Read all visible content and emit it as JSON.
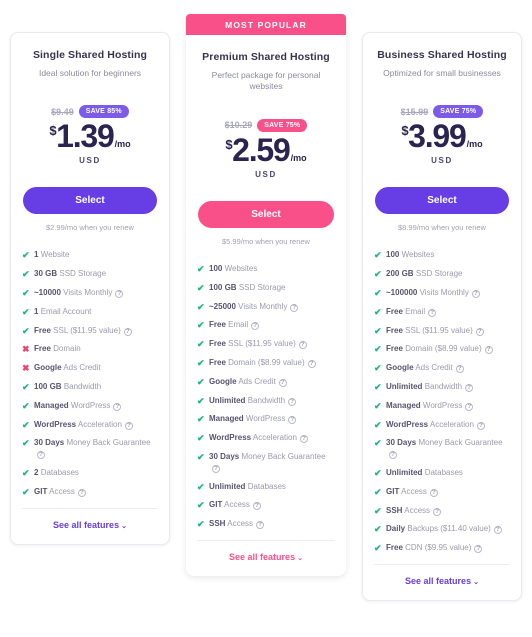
{
  "plans": [
    {
      "ribbon": null,
      "name": "Single Shared Hosting",
      "tagline": "Ideal solution for beginners",
      "old_price": "$9.49",
      "save_badge": "SAVE 85%",
      "currency_symbol": "$",
      "amount": "1.39",
      "per": "/mo",
      "currency_code": "USD",
      "select_label": "Select",
      "renew_note": "$2.99/mo when you renew",
      "see_all_label": "See all features",
      "accent": "#673de6",
      "features": [
        {
          "mark": "check",
          "bold": "1",
          "rest": "Website",
          "info": false
        },
        {
          "mark": "check",
          "bold": "30 GB",
          "rest": "SSD Storage",
          "info": false
        },
        {
          "mark": "check",
          "bold": "~10000",
          "rest": "Visits Monthly",
          "info": true
        },
        {
          "mark": "check",
          "bold": "1",
          "rest": "Email Account",
          "info": false
        },
        {
          "mark": "check",
          "bold": "Free",
          "rest": "SSL ($11.95 value)",
          "info": true
        },
        {
          "mark": "cross",
          "bold": "Free",
          "rest": "Domain",
          "info": false
        },
        {
          "mark": "cross",
          "bold": "Google",
          "rest": "Ads Credit",
          "info": false
        },
        {
          "mark": "check",
          "bold": "100 GB",
          "rest": "Bandwidth",
          "info": false
        },
        {
          "mark": "check",
          "bold": "Managed",
          "rest": "WordPress",
          "info": true
        },
        {
          "mark": "check",
          "bold": "WordPress",
          "rest": "Acceleration",
          "info": true
        },
        {
          "mark": "check",
          "bold": "30 Days",
          "rest": "Money Back Guarantee",
          "info": true
        },
        {
          "mark": "check",
          "bold": "2",
          "rest": "Databases",
          "info": false
        },
        {
          "mark": "check",
          "bold": "GIT",
          "rest": "Access",
          "info": true
        }
      ]
    },
    {
      "ribbon": "MOST POPULAR",
      "name": "Premium Shared Hosting",
      "tagline": "Perfect package for personal websites",
      "old_price": "$10.29",
      "save_badge": "SAVE 75%",
      "currency_symbol": "$",
      "amount": "2.59",
      "per": "/mo",
      "currency_code": "USD",
      "select_label": "Select",
      "renew_note": "$5.99/mo when you renew",
      "see_all_label": "See all features",
      "accent": "#fa5089",
      "features": [
        {
          "mark": "check",
          "bold": "100",
          "rest": "Websites",
          "info": false
        },
        {
          "mark": "check",
          "bold": "100 GB",
          "rest": "SSD Storage",
          "info": false
        },
        {
          "mark": "check",
          "bold": "~25000",
          "rest": "Visits Monthly",
          "info": true
        },
        {
          "mark": "check",
          "bold": "Free",
          "rest": "Email",
          "info": true
        },
        {
          "mark": "check",
          "bold": "Free",
          "rest": "SSL ($11.95 value)",
          "info": true
        },
        {
          "mark": "check",
          "bold": "Free",
          "rest": "Domain ($8.99 value)",
          "info": true
        },
        {
          "mark": "check",
          "bold": "Google",
          "rest": "Ads Credit",
          "info": true
        },
        {
          "mark": "check",
          "bold": "Unlimited",
          "rest": "Bandwidth",
          "info": true
        },
        {
          "mark": "check",
          "bold": "Managed",
          "rest": "WordPress",
          "info": true
        },
        {
          "mark": "check",
          "bold": "WordPress",
          "rest": "Acceleration",
          "info": true
        },
        {
          "mark": "check",
          "bold": "30 Days",
          "rest": "Money Back Guarantee",
          "info": true
        },
        {
          "mark": "check",
          "bold": "Unlimited",
          "rest": "Databases",
          "info": false
        },
        {
          "mark": "check",
          "bold": "GIT",
          "rest": "Access",
          "info": true
        },
        {
          "mark": "check",
          "bold": "SSH",
          "rest": "Access",
          "info": true
        }
      ]
    },
    {
      "ribbon": null,
      "name": "Business Shared Hosting",
      "tagline": "Optimized for small businesses",
      "old_price": "$15.99",
      "save_badge": "SAVE 75%",
      "currency_symbol": "$",
      "amount": "3.99",
      "per": "/mo",
      "currency_code": "USD",
      "select_label": "Select",
      "renew_note": "$8.99/mo when you renew",
      "see_all_label": "See all features",
      "accent": "#673de6",
      "features": [
        {
          "mark": "check",
          "bold": "100",
          "rest": "Websites",
          "info": false
        },
        {
          "mark": "check",
          "bold": "200 GB",
          "rest": "SSD Storage",
          "info": false
        },
        {
          "mark": "check",
          "bold": "~100000",
          "rest": "Visits Monthly",
          "info": true
        },
        {
          "mark": "check",
          "bold": "Free",
          "rest": "Email",
          "info": true
        },
        {
          "mark": "check",
          "bold": "Free",
          "rest": "SSL ($11.95 value)",
          "info": true
        },
        {
          "mark": "check",
          "bold": "Free",
          "rest": "Domain ($8.99 value)",
          "info": true
        },
        {
          "mark": "check",
          "bold": "Google",
          "rest": "Ads Credit",
          "info": true
        },
        {
          "mark": "check",
          "bold": "Unlimited",
          "rest": "Bandwidth",
          "info": true
        },
        {
          "mark": "check",
          "bold": "Managed",
          "rest": "WordPress",
          "info": true
        },
        {
          "mark": "check",
          "bold": "WordPress",
          "rest": "Acceleration",
          "info": true
        },
        {
          "mark": "check",
          "bold": "30 Days",
          "rest": "Money Back Guarantee",
          "info": true
        },
        {
          "mark": "check",
          "bold": "Unlimited",
          "rest": "Databases",
          "info": false
        },
        {
          "mark": "check",
          "bold": "GIT",
          "rest": "Access",
          "info": true
        },
        {
          "mark": "check",
          "bold": "SSH",
          "rest": "Access",
          "info": true
        },
        {
          "mark": "check",
          "bold": "Daily",
          "rest": "Backups ($11.40 value)",
          "info": true
        },
        {
          "mark": "check",
          "bold": "Free",
          "rest": "CDN ($9.95 value)",
          "info": true
        }
      ]
    }
  ],
  "glyphs": {
    "check": "✔",
    "cross": "✖",
    "chevron_down": "⌄",
    "info": "?"
  }
}
